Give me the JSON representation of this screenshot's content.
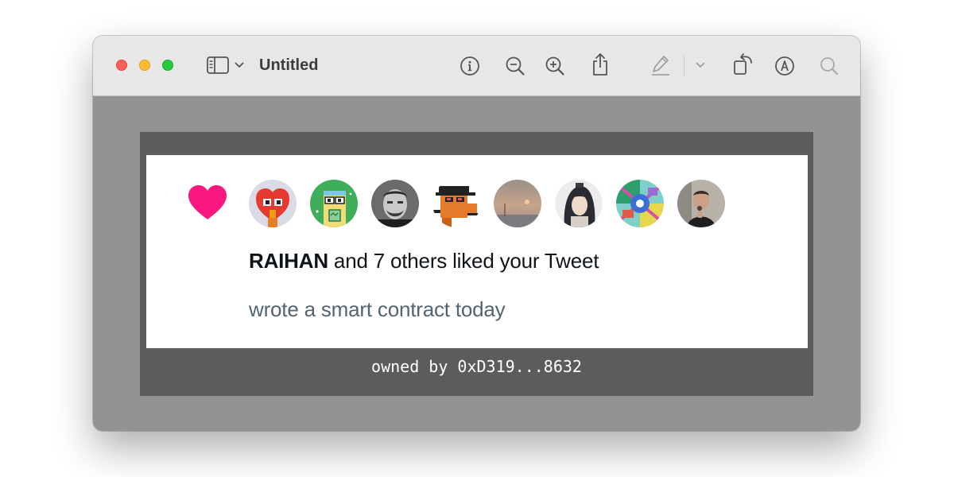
{
  "window": {
    "title": "Untitled"
  },
  "toolbar": {
    "icons": [
      "sidebar-toggle-icon",
      "chevron-down-icon",
      "info-icon",
      "zoom-out-icon",
      "zoom-in-icon",
      "share-icon",
      "markup-pen-icon",
      "chevron-down-icon",
      "rotate-icon",
      "annotate-icon",
      "search-icon"
    ]
  },
  "notification": {
    "icon": "heart-icon",
    "heart_color": "#f91880",
    "avatars": [
      {
        "label": "avatar-1"
      },
      {
        "label": "avatar-2"
      },
      {
        "label": "avatar-3"
      },
      {
        "label": "avatar-4"
      },
      {
        "label": "avatar-5"
      },
      {
        "label": "avatar-6"
      },
      {
        "label": "avatar-7"
      },
      {
        "label": "avatar-8"
      }
    ],
    "liker_name": "RAIHAN",
    "liked_text": " and 7 others liked your Tweet",
    "tweet_text": "wrote a smart contract today"
  },
  "footer": {
    "owner_text": "owned by 0xD319...8632"
  }
}
